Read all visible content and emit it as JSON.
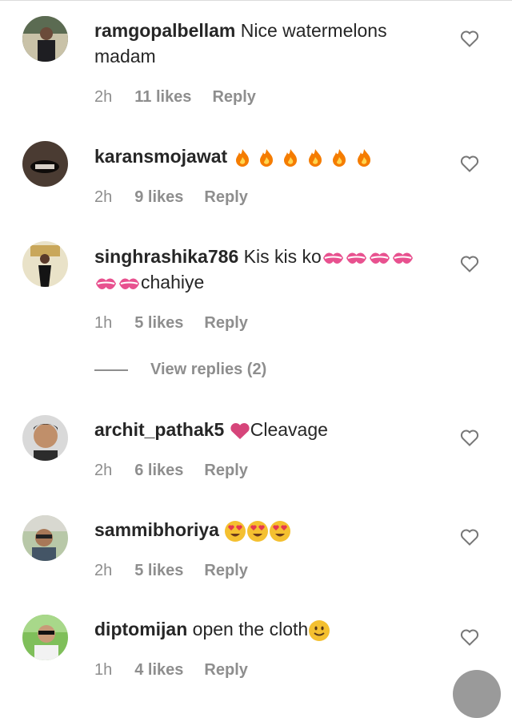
{
  "comments": [
    {
      "username": "ramgopalbellam",
      "text": " Nice watermelons madam",
      "time": "2h",
      "likes": "11 likes",
      "reply": "Reply"
    },
    {
      "username": "karansmojawat",
      "text": "",
      "time": "2h",
      "likes": "9 likes",
      "reply": "Reply",
      "emojis": [
        "fire",
        "fire",
        "fire",
        "fire",
        "fire",
        "fire"
      ]
    },
    {
      "username": "singhrashika786",
      "text": " Kis kis ko",
      "text2": "chahiye",
      "time": "1h",
      "likes": "5 likes",
      "reply": "Reply",
      "emojis": [
        "kiss",
        "kiss",
        "kiss",
        "kiss",
        "kiss",
        "kiss"
      ]
    },
    {
      "username": "archit_pathak5",
      "text": "Cleavage",
      "time": "2h",
      "likes": "6 likes",
      "reply": "Reply",
      "emojis": [
        "heart"
      ]
    },
    {
      "username": "sammibhoriya",
      "text": "",
      "time": "2h",
      "likes": "5 likes",
      "reply": "Reply",
      "emojis": [
        "heart-eyes",
        "heart-eyes",
        "heart-eyes"
      ]
    },
    {
      "username": "diptomijan",
      "text": " open the cloth",
      "time": "1h",
      "likes": "4 likes",
      "reply": "Reply",
      "emojis": [
        "smile"
      ]
    }
  ],
  "view_replies": "View replies (2)",
  "icons": {
    "like": "heart-outline-icon"
  },
  "colors": {
    "username": "#262626",
    "meta": "#8e8e8e"
  }
}
